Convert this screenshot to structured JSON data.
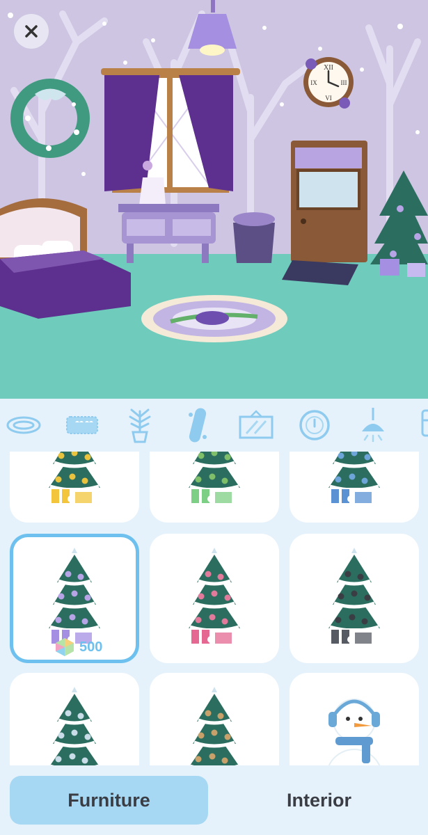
{
  "room": {
    "close_icon": "close-x",
    "clock_numerals": {
      "twelve": "XII",
      "three": "III",
      "six": "VI",
      "nine": "IX"
    }
  },
  "categories": [
    {
      "name": "rug",
      "icon": "rug-icon"
    },
    {
      "name": "pillow",
      "icon": "pillow-icon"
    },
    {
      "name": "plant",
      "icon": "plant-icon"
    },
    {
      "name": "seasonal",
      "icon": "skateboard-icon",
      "active": true
    },
    {
      "name": "frame",
      "icon": "frame-icon"
    },
    {
      "name": "clock",
      "icon": "clock-icon"
    },
    {
      "name": "lamp",
      "icon": "ceiling-lamp-icon"
    },
    {
      "name": "more",
      "icon": "cabinet-icon"
    }
  ],
  "items": [
    {
      "kind": "tree",
      "ornaments": "#e9c33e",
      "gifts": "#f2c53d"
    },
    {
      "kind": "tree",
      "ornaments": "#7fbf6a",
      "gifts": "#7ccf84"
    },
    {
      "kind": "tree",
      "ornaments": "#6ea5d9",
      "gifts": "#5a92d4"
    },
    {
      "kind": "tree",
      "ornaments": "#b7a4e6",
      "gifts": "#a48fe3",
      "selected": true,
      "price": "500"
    },
    {
      "kind": "tree",
      "ornaments": "#e27a9b",
      "gifts": "#e46892"
    },
    {
      "kind": "tree",
      "ornaments": "#3b3d44",
      "gifts": "#555a63"
    },
    {
      "kind": "tree",
      "ornaments": "#c9dde8"
    },
    {
      "kind": "tree",
      "ornaments": "#c8a06a"
    },
    {
      "kind": "snowman"
    }
  ],
  "tabs": {
    "furniture": "Furniture",
    "interior": "Interior"
  },
  "colors": {
    "accent": "#6ec1ee",
    "tab_active": "#a6d8f3",
    "floor": "#6fcbbc",
    "wall": "#cdc5e2"
  }
}
